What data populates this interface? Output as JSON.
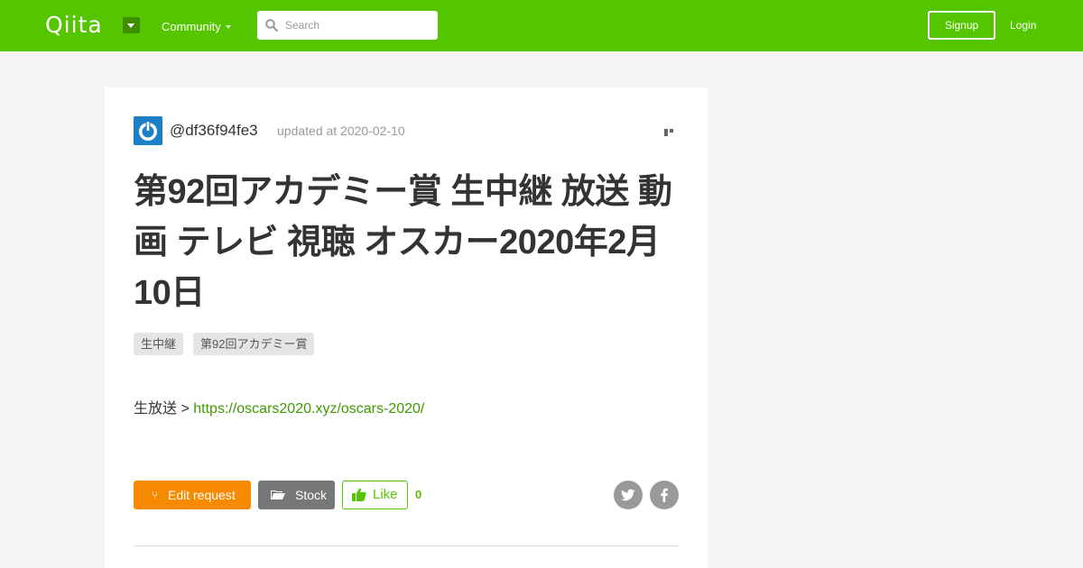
{
  "header": {
    "logo": "Qiita",
    "community_label": "Community",
    "search_placeholder": "Search",
    "signup_label": "Signup",
    "login_label": "Login",
    "brand_color": "#55c500"
  },
  "article": {
    "author": "@df36f94fe3",
    "updated": "updated at 2020-02-10",
    "title": "第92回アカデミー賞 生中継 放送 動画 テレビ 視聴 オスカー2020年2月10日",
    "tags": [
      "生中継",
      "第92回アカデミー賞"
    ],
    "body_prefix": "生放送 > ",
    "body_link": "https://oscars2020.xyz/oscars-2020/"
  },
  "actions": {
    "edit_request_label": "Edit request",
    "stock_label": "Stock",
    "like_label": "Like",
    "like_count": "0",
    "accent_orange": "#f88a00"
  },
  "icons": [
    "search-icon",
    "caret-down-icon",
    "avatar-icon",
    "more-icon",
    "branch-icon",
    "folder-icon",
    "thumbs-up-icon",
    "twitter-icon",
    "facebook-icon"
  ]
}
